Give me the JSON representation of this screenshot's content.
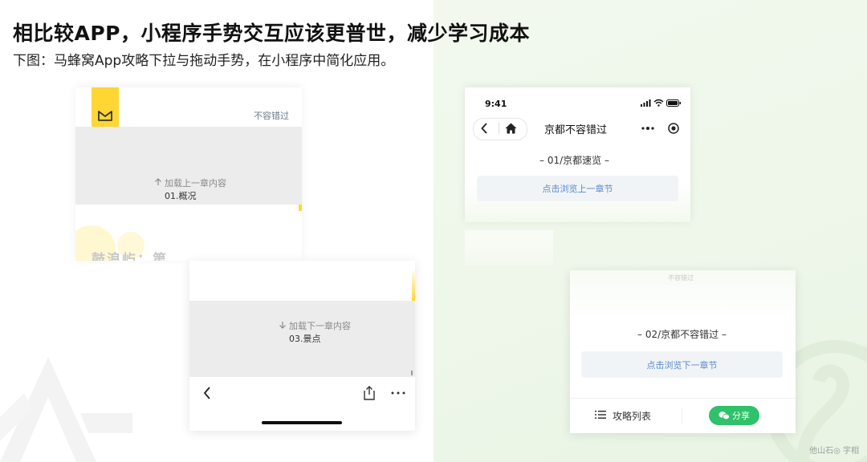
{
  "page": {
    "title": "相比较APP，小程序手势交互应该更普世，减少学习成本",
    "subtitle": "下图：马蜂窝App攻略下拉与拖动手势，在小程序中简化应用。"
  },
  "app": {
    "top_card": {
      "top_link": "不容错过",
      "load_prev": "加载上一章内容",
      "prev_chapter": "01.概况",
      "faded_heading": "鼓浪屿：第"
    },
    "bottom_card": {
      "load_next": "加载下一章内容",
      "next_chapter": "03.景点"
    }
  },
  "miniprogram": {
    "top_card": {
      "status_time": "9:41",
      "nav_title": "京都不容错过",
      "section_title": "– 01/京都速览 –",
      "prev_button": "点击浏览上一章节"
    },
    "bottom_card": {
      "faded_label": "不容错过",
      "section_title": "– 02/京都不容错过 –",
      "next_button": "点击浏览下一章节",
      "list_label": "攻略列表",
      "share_label": "分享"
    }
  },
  "watermark": "他山石◎ 字相",
  "colors": {
    "brand_yellow": "#ffd633",
    "share_green": "#2fc26a",
    "link_blue": "#5b8ac8"
  }
}
